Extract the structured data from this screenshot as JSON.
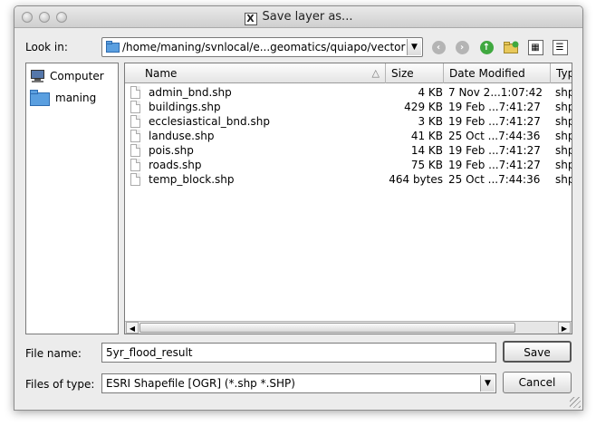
{
  "window": {
    "title": "Save layer as..."
  },
  "toolbar": {
    "lookin_label": "Look in:",
    "path": "/home/maning/svnlocal/e...geomatics/quiapo/vector",
    "icons": [
      "back-icon",
      "forward-icon",
      "parent-directory-icon",
      "new-folder-icon",
      "list-view-icon",
      "detail-view-icon"
    ]
  },
  "sidebar": {
    "items": [
      {
        "label": "Computer",
        "icon": "computer-icon"
      },
      {
        "label": "maning",
        "icon": "folder-icon"
      }
    ]
  },
  "filelist": {
    "columns": [
      "Name",
      "Size",
      "Date Modified",
      "Typ"
    ],
    "rows": [
      {
        "name": "admin_bnd.shp",
        "size": "4 KB",
        "date": "7 Nov 2...1:07:42",
        "type": "shp"
      },
      {
        "name": "buildings.shp",
        "size": "429 KB",
        "date": "19 Feb ...7:41:27",
        "type": "shp"
      },
      {
        "name": "ecclesiastical_bnd.shp",
        "size": "3 KB",
        "date": "19 Feb ...7:41:27",
        "type": "shp"
      },
      {
        "name": "landuse.shp",
        "size": "41 KB",
        "date": "25 Oct ...7:44:36",
        "type": "shp"
      },
      {
        "name": "pois.shp",
        "size": "14 KB",
        "date": "19 Feb ...7:41:27",
        "type": "shp"
      },
      {
        "name": "roads.shp",
        "size": "75 KB",
        "date": "19 Feb ...7:41:27",
        "type": "shp"
      },
      {
        "name": "temp_block.shp",
        "size": "464 bytes",
        "date": "25 Oct ...7:44:36",
        "type": "shp"
      }
    ]
  },
  "form": {
    "filename_label": "File name:",
    "filename_value": "5yr_flood_result",
    "filetype_label": "Files of type:",
    "filetype_value": "ESRI Shapefile [OGR] (*.shp *.SHP)",
    "save_label": "Save",
    "cancel_label": "Cancel"
  },
  "colors": {
    "folder_blue": "#5a9fe0",
    "nav_gray": "#b4b4b4",
    "up_green": "#3fa83f"
  }
}
